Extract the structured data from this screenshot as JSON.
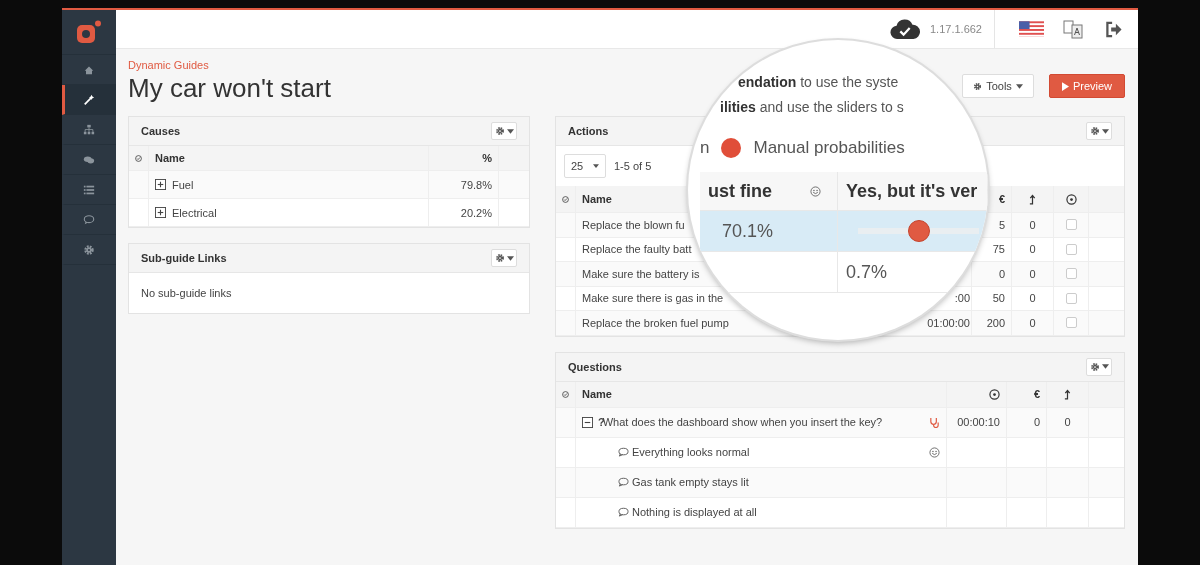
{
  "header": {
    "version": "1.17.1.662"
  },
  "sidebar": {
    "items": [
      {
        "kind": "home",
        "selected": false
      },
      {
        "kind": "wand",
        "selected": true
      },
      {
        "kind": "sitemap",
        "selected": false
      },
      {
        "kind": "comments",
        "selected": false
      },
      {
        "kind": "list",
        "selected": false
      },
      {
        "kind": "comment",
        "selected": false
      },
      {
        "kind": "gear",
        "selected": false
      }
    ]
  },
  "page": {
    "breadcrumb": "Dynamic Guides",
    "title": "My car won't start"
  },
  "toolbar": {
    "buttons": [
      {
        "label": "Tools",
        "kind": "dropdown"
      },
      {
        "label": "Preview",
        "kind": "primary"
      }
    ]
  },
  "causes": {
    "title": "Causes",
    "columns": [
      "Name",
      "%"
    ],
    "rows": [
      {
        "name": "Fuel",
        "value": "79.8%",
        "expanded": false
      },
      {
        "name": "Electrical",
        "value": "20.2%",
        "expanded": false
      }
    ]
  },
  "sub_guide_links": {
    "title": "Sub-guide Links",
    "empty_text": "No sub-guide links"
  },
  "actions": {
    "title": "Actions",
    "page_size": "25",
    "range": "1-5 of 5",
    "columns": [
      "Name",
      "€"
    ],
    "rows": [
      {
        "name": "Replace the blown fu",
        "cost": "5",
        "column_5": "0",
        "checked": false
      },
      {
        "name": "Replace the faulty batt",
        "cost": "75",
        "column_5": "0",
        "checked": false
      },
      {
        "name": "Make sure the battery is",
        "cost": "0",
        "column_5": "0",
        "checked": false
      },
      {
        "name": "Make sure there is gas in the",
        "time": ":00",
        "cost": "50",
        "column_5": "0",
        "checked": false
      },
      {
        "name": "Replace the broken fuel pump",
        "time": "01:00:00",
        "cost": "200",
        "column_5": "0",
        "checked": false
      }
    ]
  },
  "questions": {
    "title": "Questions",
    "columns": [
      "Name",
      "€"
    ],
    "rows": [
      {
        "text": "What does the dashboard show when you insert the key?",
        "marker": "?",
        "expanded": true,
        "time": "00:00:10",
        "cost": "0",
        "column_5": "0",
        "children": [
          {
            "text": "Everything looks normal",
            "smiley": true
          },
          {
            "text": "Gas tank empty stays lit",
            "smiley": false
          },
          {
            "text": "Nothing is displayed at all",
            "smiley": false
          }
        ]
      }
    ]
  },
  "magnifier": {
    "lines": [
      "**endation** to use the syste",
      "**ilities** and use the sliders to s"
    ],
    "legend": {
      "prefix": "n",
      "label": "Manual probabilities",
      "color": "#e04e39"
    },
    "columns": [
      "ust fine",
      "Yes, but it's ver"
    ],
    "rows": [
      {
        "selected": true,
        "column_1": "70.1%",
        "level": 0.5
      },
      {
        "selected": false,
        "column_2": "0.7%"
      }
    ]
  }
}
